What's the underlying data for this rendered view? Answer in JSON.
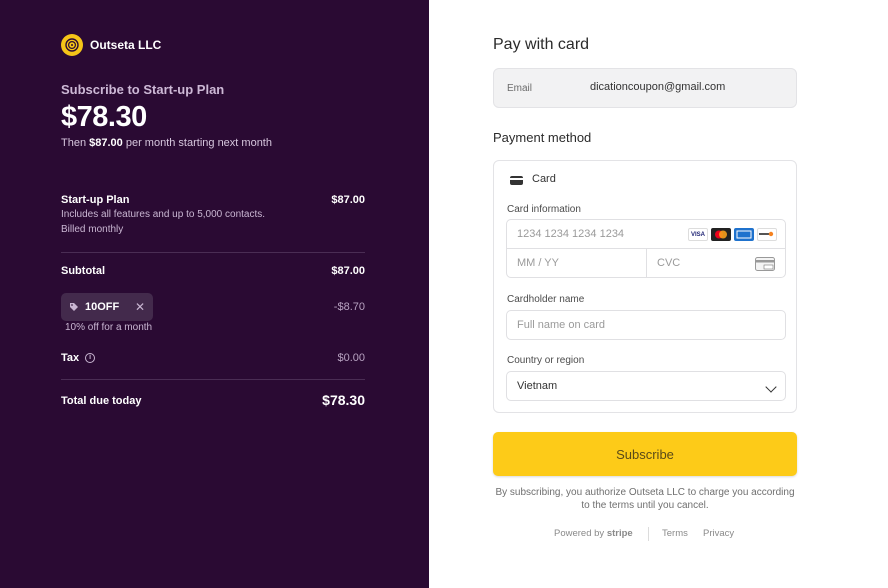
{
  "merchant": {
    "name": "Outseta LLC"
  },
  "summary": {
    "subscribe_label": "Subscribe to Start-up Plan",
    "amount": "$78.30",
    "then_prefix": "Then ",
    "then_amount": "$87.00",
    "then_suffix": " per month starting next month",
    "plan_name": "Start-up Plan",
    "plan_desc": "Includes all features and up to 5,000 contacts.",
    "plan_billing": "Billed monthly",
    "plan_amount": "$87.00",
    "subtotal_label": "Subtotal",
    "subtotal_amount": "$87.00",
    "coupon_code": "10OFF",
    "coupon_desc": "10% off for a month",
    "coupon_amount": "-$8.70",
    "tax_label": "Tax",
    "tax_amount": "$0.00",
    "total_label": "Total due today",
    "total_amount": "$78.30"
  },
  "payment": {
    "title": "Pay with card",
    "email_label": "Email",
    "email_value": "dicationcoupon@gmail.com",
    "method_title": "Payment method",
    "method_card": "Card",
    "card_info_label": "Card information",
    "card_number_placeholder": "1234 1234 1234 1234",
    "expiry_placeholder": "MM / YY",
    "cvc_placeholder": "CVC",
    "cardholder_label": "Cardholder name",
    "cardholder_placeholder": "Full name on card",
    "country_label": "Country or region",
    "country_value": "Vietnam",
    "card_brands": [
      "VISA",
      "mastercard",
      "AMEX",
      "DISCOVER"
    ],
    "subscribe_button": "Subscribe",
    "legal_text": "By subscribing, you authorize Outseta LLC to charge you according to the terms until you cancel.",
    "powered_by": "Powered by",
    "powered_brand": "stripe",
    "terms_link": "Terms",
    "privacy_link": "Privacy"
  },
  "colors": {
    "left_bg": "#2a0a33",
    "accent_button": "#fdcb18"
  }
}
